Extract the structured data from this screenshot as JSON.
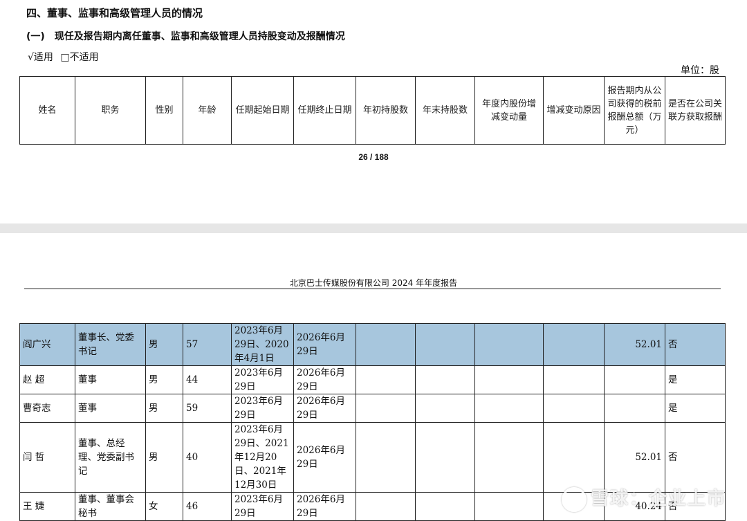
{
  "section_title": "四、董事、监事和高级管理人员的情况",
  "subsection_title": "(一)　现任及报告期内离任董事、监事和高级管理人员持股变动及报酬情况",
  "options": {
    "applicable": "√适用",
    "not_applicable": "□不适用"
  },
  "unit": "单位：股",
  "headers": [
    "姓名",
    "职务",
    "性别",
    "年龄",
    "任期起始日期",
    "任期终止日期",
    "年初持股数",
    "年末持股数",
    "年度内股份增减变动量",
    "增减变动原因",
    "报告期内从公司获得的税前报酬总额（万元）",
    "是否在公司关联方获取报酬"
  ],
  "page_number": "26 / 188",
  "running_header": "北京巴士传媒股份有限公司 2024 年年度报告",
  "rows": [
    {
      "name": "阎广兴",
      "position": "董事长、党委书记",
      "gender": "男",
      "age": "57",
      "start": "2023年6月29日、2020年4月1日",
      "end": "2026年6月29日",
      "begin_shares": "",
      "end_shares": "",
      "change": "",
      "reason": "",
      "pay": "52.01",
      "related": "否"
    },
    {
      "name": "赵 超",
      "position": "董事",
      "gender": "男",
      "age": "44",
      "start": "2023年6月29日",
      "end": "2026年6月29日",
      "begin_shares": "",
      "end_shares": "",
      "change": "",
      "reason": "",
      "pay": "",
      "related": "是"
    },
    {
      "name": "曹奇志",
      "position": "董事",
      "gender": "男",
      "age": "59",
      "start": "2023年6月29日",
      "end": "2026年6月29日",
      "begin_shares": "",
      "end_shares": "",
      "change": "",
      "reason": "",
      "pay": "",
      "related": "是"
    },
    {
      "name": "闫 哲",
      "position": "董事、总经理、党委副书记",
      "gender": "男",
      "age": "40",
      "start": "2023年6月29日、2021年12月20日、2021年12月30日",
      "end": "2026年6月29日",
      "begin_shares": "",
      "end_shares": "",
      "change": "",
      "reason": "",
      "pay": "52.01",
      "related": "否"
    },
    {
      "name": "王 婕",
      "position": "董事、董事会秘书",
      "gender": "女",
      "age": "46",
      "start": "2023年6月29日",
      "end": "2026年6月29日",
      "begin_shares": "",
      "end_shares": "",
      "change": "",
      "reason": "",
      "pay": "40.24",
      "related": "否"
    }
  ],
  "watermark": "雪球：企业上市",
  "colors": {
    "highlight": "#a7c6dd",
    "gap": "#e6e6e6"
  }
}
